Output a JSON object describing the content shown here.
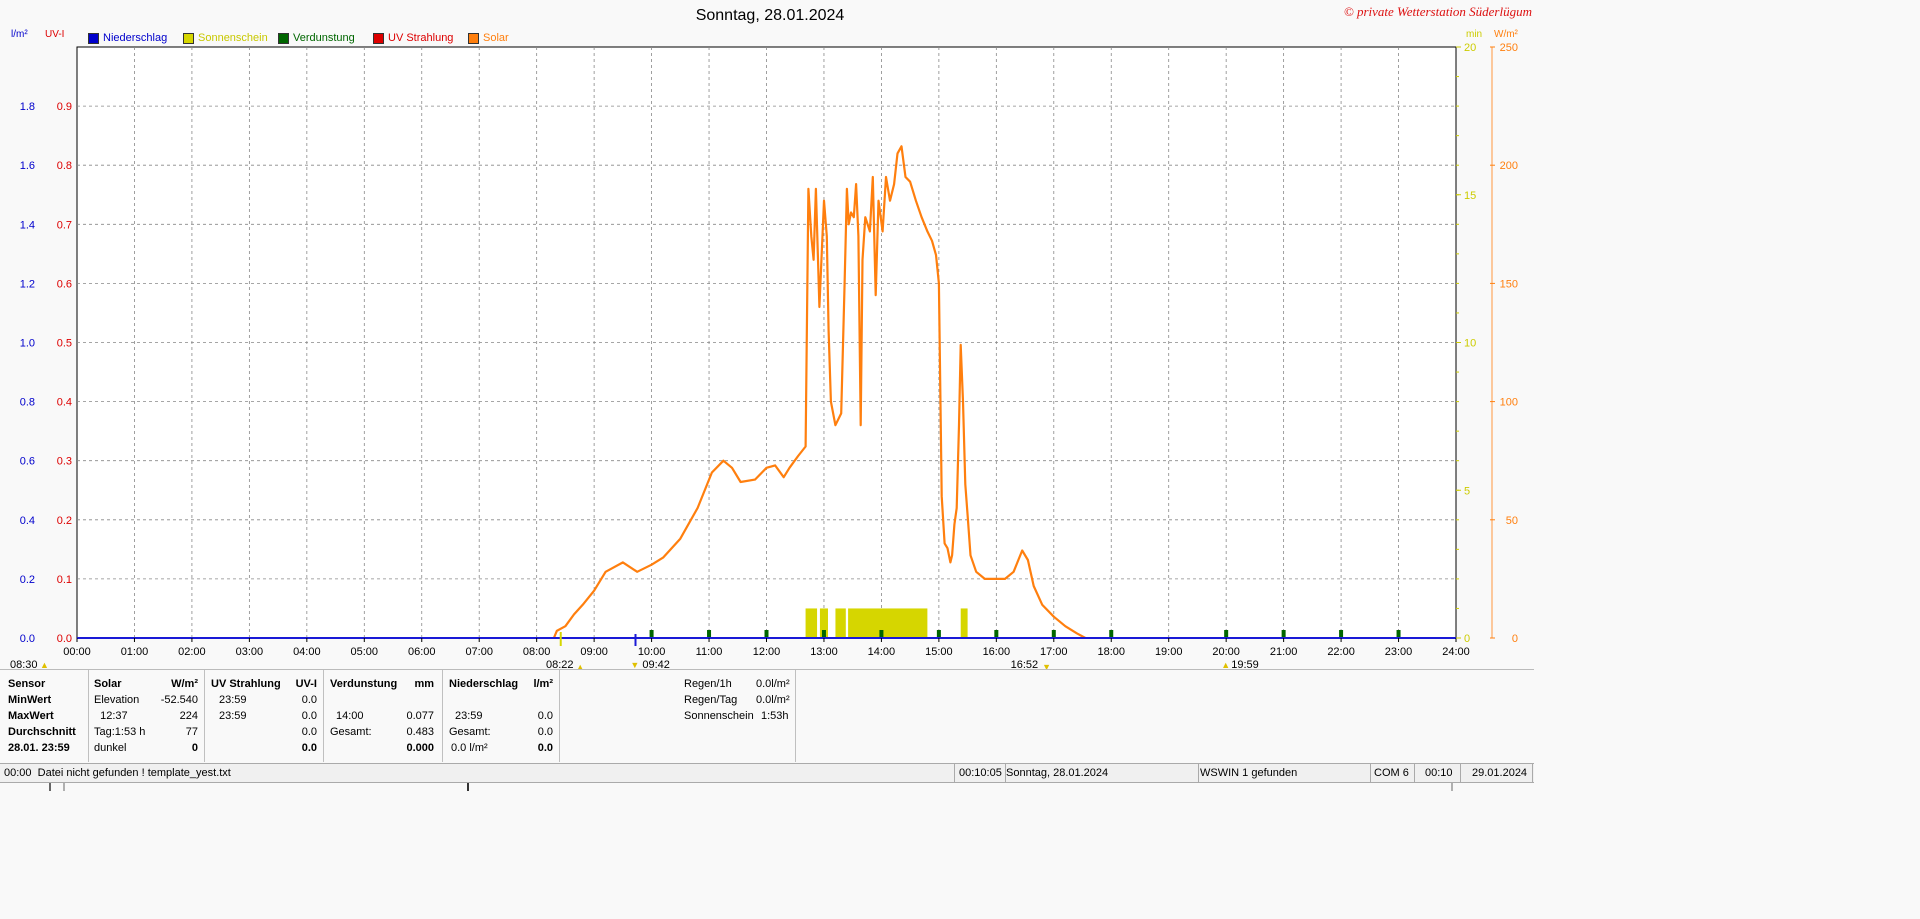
{
  "title": "Sonntag, 28.01.2024",
  "copyright": "© private Wetterstation Süderlügum",
  "axis_labels": {
    "left1_unit": "l/m²",
    "left2_unit": "UV-I",
    "right1_unit": "min",
    "right2_unit": "W/m²"
  },
  "legend": [
    {
      "label": "Niederschlag",
      "color": "#0000cc"
    },
    {
      "label": "Sonnenschein",
      "color": "#d6d600"
    },
    {
      "label": "Verdunstung",
      "color": "#006600"
    },
    {
      "label": "UV Strahlung",
      "color": "#dd0000"
    },
    {
      "label": "Solar",
      "color": "#ff7f0e"
    }
  ],
  "colors": {
    "rain": "#1a1ad6",
    "uv": "#dd0000",
    "sunshine": "#d6d600",
    "evap": "#006600",
    "solar": "#ff7f0e"
  },
  "markers": {
    "sunrise": "08:30",
    "sunset": "16:52",
    "moonrise": "08:22",
    "moon_mid": "09:42",
    "moonset": "19:59"
  },
  "chart_data": {
    "type": "line",
    "title": "Sonntag, 28.01.2024",
    "x_ticks": [
      "00:00",
      "01:00",
      "02:00",
      "03:00",
      "04:00",
      "05:00",
      "06:00",
      "07:00",
      "08:00",
      "09:00",
      "10:00",
      "11:00",
      "12:00",
      "13:00",
      "14:00",
      "15:00",
      "16:00",
      "17:00",
      "18:00",
      "19:00",
      "20:00",
      "21:00",
      "22:00",
      "23:00",
      "24:00"
    ],
    "xlim_hours": [
      0,
      24
    ],
    "y_left_rain_ticks": [
      "0.0",
      "0.2",
      "0.4",
      "0.6",
      "0.8",
      "1.0",
      "1.2",
      "1.4",
      "1.6",
      "1.8"
    ],
    "y_left_uv_ticks": [
      "0.0",
      "0.1",
      "0.2",
      "0.3",
      "0.4",
      "0.5",
      "0.6",
      "0.7",
      "0.8",
      "0.9"
    ],
    "y_right_min_ticks": [
      "0",
      "5",
      "10",
      "15",
      "20"
    ],
    "y_right_solar_ticks": [
      "0",
      "50",
      "100",
      "150",
      "200",
      "250"
    ],
    "ylim_solar": [
      0,
      250
    ],
    "ylim_sunshine_min": [
      0,
      20
    ],
    "grid": true,
    "series": [
      {
        "name": "Solar",
        "unit": "W/m²",
        "points": [
          [
            8.3,
            0
          ],
          [
            8.35,
            3
          ],
          [
            8.5,
            5
          ],
          [
            8.65,
            10
          ],
          [
            8.8,
            14
          ],
          [
            9.0,
            20
          ],
          [
            9.2,
            28
          ],
          [
            9.5,
            32
          ],
          [
            9.75,
            28
          ],
          [
            10.0,
            31
          ],
          [
            10.2,
            34
          ],
          [
            10.5,
            42
          ],
          [
            10.8,
            55
          ],
          [
            11.05,
            70
          ],
          [
            11.25,
            75
          ],
          [
            11.4,
            72
          ],
          [
            11.55,
            66
          ],
          [
            11.8,
            67
          ],
          [
            12.0,
            72
          ],
          [
            12.15,
            73
          ],
          [
            12.3,
            68
          ],
          [
            12.4,
            72
          ],
          [
            12.55,
            77
          ],
          [
            12.68,
            81
          ],
          [
            12.73,
            190
          ],
          [
            12.78,
            170
          ],
          [
            12.82,
            160
          ],
          [
            12.86,
            190
          ],
          [
            12.92,
            140
          ],
          [
            13.0,
            185
          ],
          [
            13.05,
            170
          ],
          [
            13.08,
            130
          ],
          [
            13.12,
            100
          ],
          [
            13.2,
            90
          ],
          [
            13.3,
            95
          ],
          [
            13.36,
            150
          ],
          [
            13.4,
            190
          ],
          [
            13.43,
            175
          ],
          [
            13.47,
            180
          ],
          [
            13.52,
            178
          ],
          [
            13.56,
            192
          ],
          [
            13.6,
            170
          ],
          [
            13.64,
            90
          ],
          [
            13.67,
            160
          ],
          [
            13.72,
            178
          ],
          [
            13.8,
            172
          ],
          [
            13.85,
            195
          ],
          [
            13.9,
            145
          ],
          [
            13.95,
            185
          ],
          [
            14.02,
            172
          ],
          [
            14.08,
            195
          ],
          [
            14.15,
            185
          ],
          [
            14.22,
            192
          ],
          [
            14.28,
            205
          ],
          [
            14.35,
            208
          ],
          [
            14.42,
            195
          ],
          [
            14.5,
            193
          ],
          [
            14.6,
            185
          ],
          [
            14.7,
            178
          ],
          [
            14.8,
            172
          ],
          [
            14.88,
            168
          ],
          [
            14.95,
            162
          ],
          [
            15.0,
            150
          ],
          [
            15.05,
            60
          ],
          [
            15.1,
            40
          ],
          [
            15.15,
            38
          ],
          [
            15.2,
            32
          ],
          [
            15.23,
            35
          ],
          [
            15.27,
            48
          ],
          [
            15.31,
            55
          ],
          [
            15.35,
            90
          ],
          [
            15.38,
            124
          ],
          [
            15.42,
            100
          ],
          [
            15.46,
            65
          ],
          [
            15.5,
            52
          ],
          [
            15.55,
            35
          ],
          [
            15.65,
            28
          ],
          [
            15.8,
            25
          ],
          [
            16.0,
            25
          ],
          [
            16.15,
            25
          ],
          [
            16.3,
            28
          ],
          [
            16.45,
            37
          ],
          [
            16.55,
            33
          ],
          [
            16.65,
            22
          ],
          [
            16.8,
            14
          ],
          [
            17.0,
            9
          ],
          [
            17.2,
            5
          ],
          [
            17.4,
            2
          ],
          [
            17.55,
            0
          ]
        ]
      },
      {
        "name": "Sonnenschein",
        "unit": "min",
        "intervals": [
          [
            12.68,
            12.88
          ],
          [
            12.93,
            13.07
          ],
          [
            13.2,
            13.38
          ],
          [
            13.42,
            14.8
          ],
          [
            15.38,
            15.5
          ]
        ],
        "value": 1
      },
      {
        "name": "Niederschlag",
        "unit": "l/m²",
        "values": [
          0
        ]
      },
      {
        "name": "UV Strahlung",
        "unit": "UV-I",
        "values": [
          0
        ]
      },
      {
        "name": "Verdunstung",
        "unit": "mm",
        "hourly_marks": [
          10,
          11,
          12,
          13,
          14,
          15,
          16,
          17,
          18,
          20,
          21,
          22,
          23
        ]
      }
    ]
  },
  "stats": {
    "col0": {
      "header": "Sensor",
      "rows": [
        "MinWert",
        "MaxWert",
        "Durchschnitt",
        "28.01.  23:59"
      ]
    },
    "col1": {
      "header": "Solar",
      "unit": "W/m²",
      "rows": [
        [
          "Elevation",
          "-52.540"
        ],
        [
          "  12:37",
          "224"
        ],
        [
          "Tag:1:53 h",
          "77"
        ],
        [
          "dunkel",
          "0"
        ]
      ]
    },
    "col2": {
      "header": "UV Strahlung",
      "unit": "UV-I",
      "rows": [
        [
          "23:59",
          "0.0"
        ],
        [
          "23:59",
          "0.0"
        ],
        [
          "",
          "0.0"
        ],
        [
          "",
          "0.0"
        ]
      ]
    },
    "col3": {
      "header": "Verdunstung",
      "unit": "mm",
      "rows": [
        [
          "",
          ""
        ],
        [
          "14:00",
          "0.077"
        ],
        [
          "Gesamt:",
          "0.483"
        ],
        [
          "",
          "0.000"
        ]
      ]
    },
    "col4": {
      "header": "Niederschlag",
      "unit": "l/m²",
      "rows": [
        [
          "",
          ""
        ],
        [
          "23:59",
          "0.0"
        ],
        [
          "Gesamt:",
          "0.0"
        ],
        [
          "0.0 l/m²",
          "0.0"
        ]
      ]
    },
    "col5": {
      "rows": [
        [
          "Regen/1h",
          "0.0l/m²"
        ],
        [
          "Regen/Tag",
          "0.0l/m²"
        ],
        [
          "Sonnenschein",
          "1:53h"
        ]
      ]
    }
  },
  "status": {
    "left": "00:00  Datei nicht gefunden ! template_yest.txt",
    "time": "00:10:05",
    "date": "Sonntag, 28.01.2024",
    "device": "WSWIN 1 gefunden",
    "port": "COM 6",
    "clock": "00:10",
    "today": "29.01.2024"
  }
}
